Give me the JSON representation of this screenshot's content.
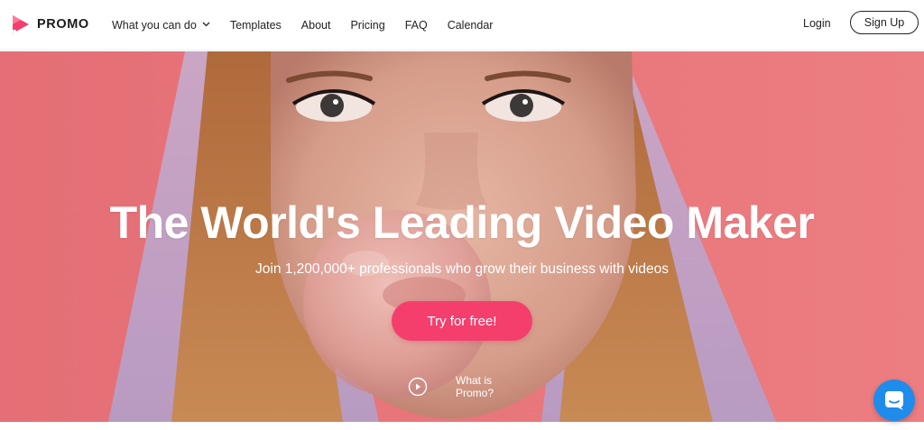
{
  "brand": {
    "name": "PROMO"
  },
  "nav": {
    "links": [
      "What you can do",
      "Templates",
      "About",
      "Pricing",
      "FAQ",
      "Calendar"
    ],
    "login": "Login",
    "signup": "Sign Up"
  },
  "hero": {
    "headline": "The World's Leading Video Maker",
    "subheadline": "Join 1,200,000+ professionals who grow their business with videos",
    "cta": "Try for free!",
    "video_link_line1": "What is",
    "video_link_line2": "Promo?"
  },
  "icons": {
    "logo": "promo-play-logo-icon",
    "dropdown": "chevron-down-icon",
    "play": "play-circle-icon",
    "chat": "chat-bubble-icon"
  },
  "colors": {
    "accent": "#f43f6d",
    "hero_background": "#e9787c",
    "chat_button": "#1f8ceb",
    "text_dark": "#222222"
  }
}
